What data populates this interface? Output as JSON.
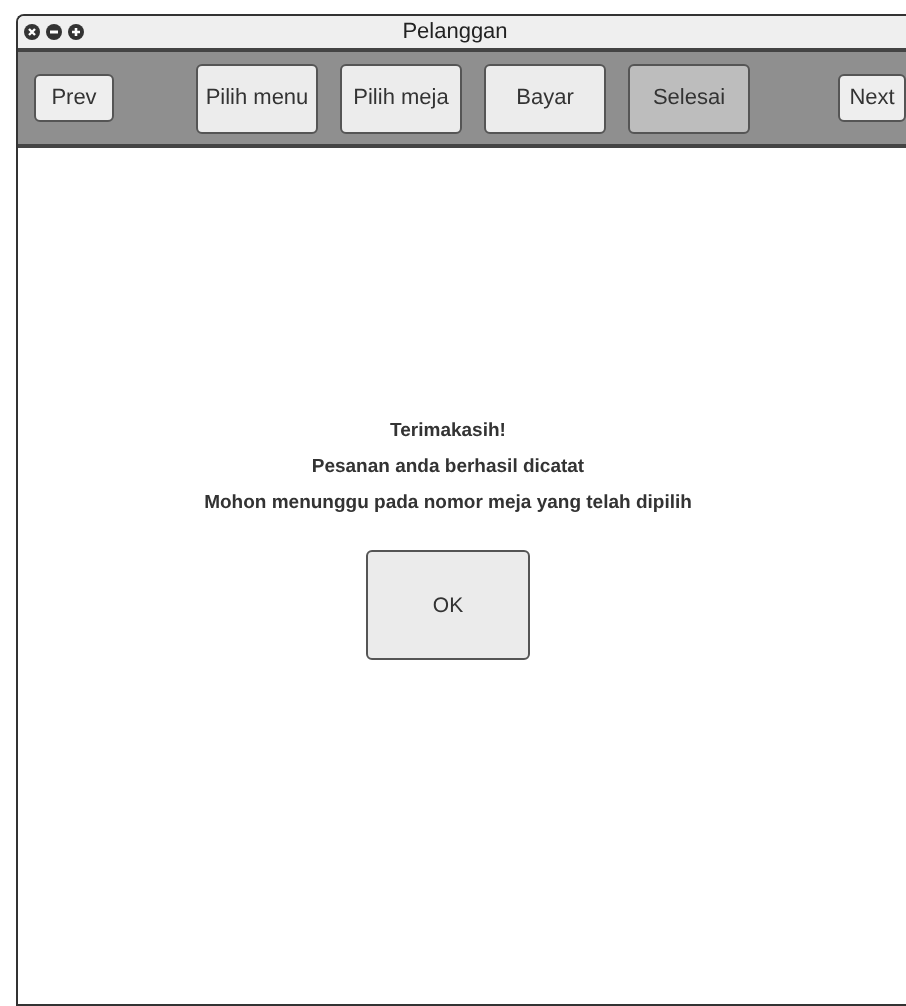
{
  "window": {
    "title": "Pelanggan"
  },
  "toolbar": {
    "prev": "Prev",
    "next": "Next",
    "steps": [
      {
        "label": "Pilih menu",
        "selected": false
      },
      {
        "label": "Pilih meja",
        "selected": false
      },
      {
        "label": "Bayar",
        "selected": false
      },
      {
        "label": "Selesai",
        "selected": true
      }
    ]
  },
  "message": {
    "lines": [
      "Terimakasih!",
      "Pesanan anda berhasil dicatat",
      "Mohon menunggu pada nomor meja yang telah dipilih"
    ],
    "button": "OK"
  }
}
